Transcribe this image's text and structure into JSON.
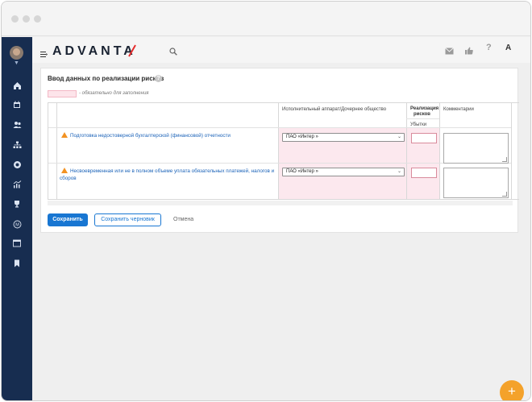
{
  "app": {
    "logo_text": "ADVANTA",
    "brand_color": "#1a2332",
    "accent_color": "#1876d2",
    "sidebar_color": "#172d50"
  },
  "topbar": {
    "icons": [
      "menu-icon",
      "search-icon",
      "mail-icon",
      "thumbs-up-icon",
      "help-icon",
      "profile-initial-icon"
    ],
    "profile_initial": "A",
    "help_mark": "?"
  },
  "sidebar": {
    "items": [
      "home-icon",
      "calendar-icon",
      "users-icon",
      "org-chart-icon",
      "circle-icon",
      "analytics-icon",
      "trophy-icon",
      "m-icon",
      "calendar-grid-icon",
      "bookmark-icon"
    ],
    "m_label": "M"
  },
  "form": {
    "title": "Ввод данных по реализации рисков",
    "help_mark": "?",
    "legend_text": "- обязательно для заполнения",
    "columns": {
      "org": "Исполнительный аппарат/Дочернее общество",
      "realization_line1": "Реализация",
      "realization_line2": "рисков",
      "losses": "Убытки",
      "comments": "Комментарии"
    },
    "rows": [
      {
        "risk": "Подготовка недостоверной бухгалтерской (финансовой) отчетности",
        "org_value": "ПАО «Интер »",
        "losses": "",
        "comment": ""
      },
      {
        "risk": "Несвоевременная или не в полном объеме уплата обязательных платежей, налогов и сборов",
        "org_value": "ПАО «Интер »",
        "losses": "",
        "comment": ""
      }
    ],
    "buttons": {
      "save": "Сохранить",
      "save_draft": "Сохранить черновик",
      "cancel": "Отмена"
    }
  },
  "fab_label": "+",
  "select_chevron": "⌄"
}
